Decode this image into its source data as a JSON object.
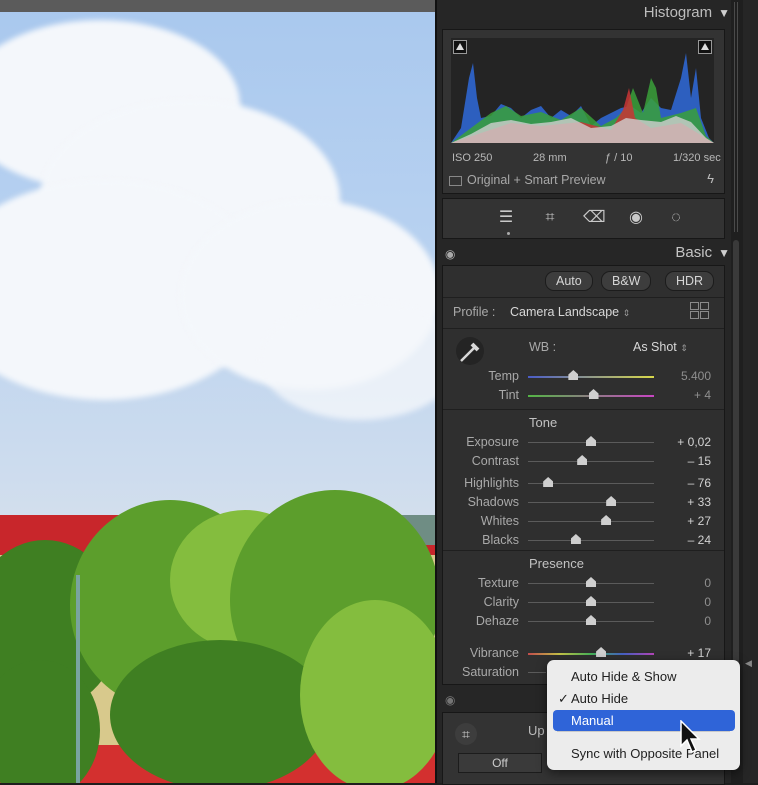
{
  "histogram": {
    "title": "Histogram",
    "exif": {
      "iso": "ISO 250",
      "focal": "28 mm",
      "aperture": "ƒ / 10",
      "shutter": "1/320 sec"
    },
    "preview": "Original + Smart Preview"
  },
  "basic": {
    "title": "Basic",
    "treatments": [
      "Auto",
      "B&W",
      "HDR"
    ],
    "profile_label": "Profile :",
    "profile_value": "Camera Landscape",
    "wb_label": "WB :",
    "wb_value": "As Shot",
    "temp": {
      "label": "Temp",
      "value": "5.400",
      "pos": 0.36
    },
    "tint": {
      "label": "Tint",
      "value": "+ 4",
      "pos": 0.52
    },
    "tone_title": "Tone",
    "tone": [
      {
        "label": "Exposure",
        "value": "+ 0,02",
        "pos": 0.5
      },
      {
        "label": "Contrast",
        "value": "– 15",
        "pos": 0.43
      },
      {
        "label": "Highlights",
        "value": "– 76",
        "pos": 0.16
      },
      {
        "label": "Shadows",
        "value": "+ 33",
        "pos": 0.66
      },
      {
        "label": "Whites",
        "value": "+ 27",
        "pos": 0.62
      },
      {
        "label": "Blacks",
        "value": "– 24",
        "pos": 0.38
      }
    ],
    "presence_title": "Presence",
    "presence": [
      {
        "label": "Texture",
        "value": "0",
        "pos": 0.5
      },
      {
        "label": "Clarity",
        "value": "0",
        "pos": 0.5
      },
      {
        "label": "Dehaze",
        "value": "0",
        "pos": 0.5
      }
    ],
    "vibrance": {
      "label": "Vibrance",
      "value": "+ 17",
      "pos": 0.58
    },
    "saturation": {
      "label": "Saturation"
    }
  },
  "lower": {
    "label": "Up",
    "off": "Off"
  },
  "context_menu": {
    "items": [
      "Auto Hide & Show",
      "Auto Hide",
      "Manual",
      "Sync with Opposite Panel"
    ],
    "checked": "Auto Hide",
    "highlighted": "Manual"
  },
  "colors": {
    "accent": "#2f64d8",
    "panel": "#262626",
    "box": "#333333"
  }
}
